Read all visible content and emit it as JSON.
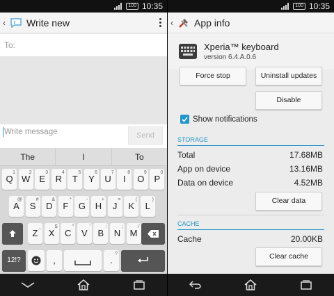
{
  "status": {
    "battery": "100",
    "time": "10:35"
  },
  "compose": {
    "title": "Write new",
    "to_label": "To:",
    "message_placeholder": "Write message",
    "send_label": "Send"
  },
  "keyboard": {
    "suggestions": [
      "The",
      "I",
      "To"
    ],
    "row1": [
      [
        "Q",
        "1"
      ],
      [
        "W",
        "2"
      ],
      [
        "E",
        "3"
      ],
      [
        "R",
        "4"
      ],
      [
        "T",
        "5"
      ],
      [
        "Y",
        "6"
      ],
      [
        "U",
        "7"
      ],
      [
        "I",
        "8"
      ],
      [
        "O",
        "9"
      ],
      [
        "P",
        "0"
      ]
    ],
    "row2": [
      [
        "A",
        "@"
      ],
      [
        "S",
        "#"
      ],
      [
        "D",
        "&"
      ],
      [
        "F",
        "*"
      ],
      [
        "G",
        "-"
      ],
      [
        "H",
        "+"
      ],
      [
        "J",
        "="
      ],
      [
        "K",
        "("
      ],
      [
        "L",
        ")"
      ]
    ],
    "row3": [
      [
        "Z",
        "_"
      ],
      [
        "X",
        "$"
      ],
      [
        "C",
        "\""
      ],
      [
        "V",
        "'"
      ],
      [
        "B",
        ":"
      ],
      [
        "N",
        ";"
      ],
      [
        "M",
        "/"
      ]
    ],
    "symbols_label": "12!?",
    "comma": ",",
    "period": ".",
    "period_alt": "?"
  },
  "appinfo": {
    "title": "App info",
    "app_name": "Xperia™ keyboard",
    "version": "version 6.4.A.0.6",
    "force_stop": "Force stop",
    "uninstall_updates": "Uninstall updates",
    "disable": "Disable",
    "show_notifications": "Show notifications",
    "storage_header": "STORAGE",
    "total_label": "Total",
    "total_value": "17.68MB",
    "app_label": "App on device",
    "app_value": "13.16MB",
    "data_label": "Data on device",
    "data_value": "4.52MB",
    "clear_data": "Clear data",
    "cache_header": "CACHE",
    "cache_label": "Cache",
    "cache_value": "20.00KB",
    "clear_cache": "Clear cache"
  },
  "colors": {
    "accent": "#2196c9",
    "navbar": "#1a1a1a"
  }
}
